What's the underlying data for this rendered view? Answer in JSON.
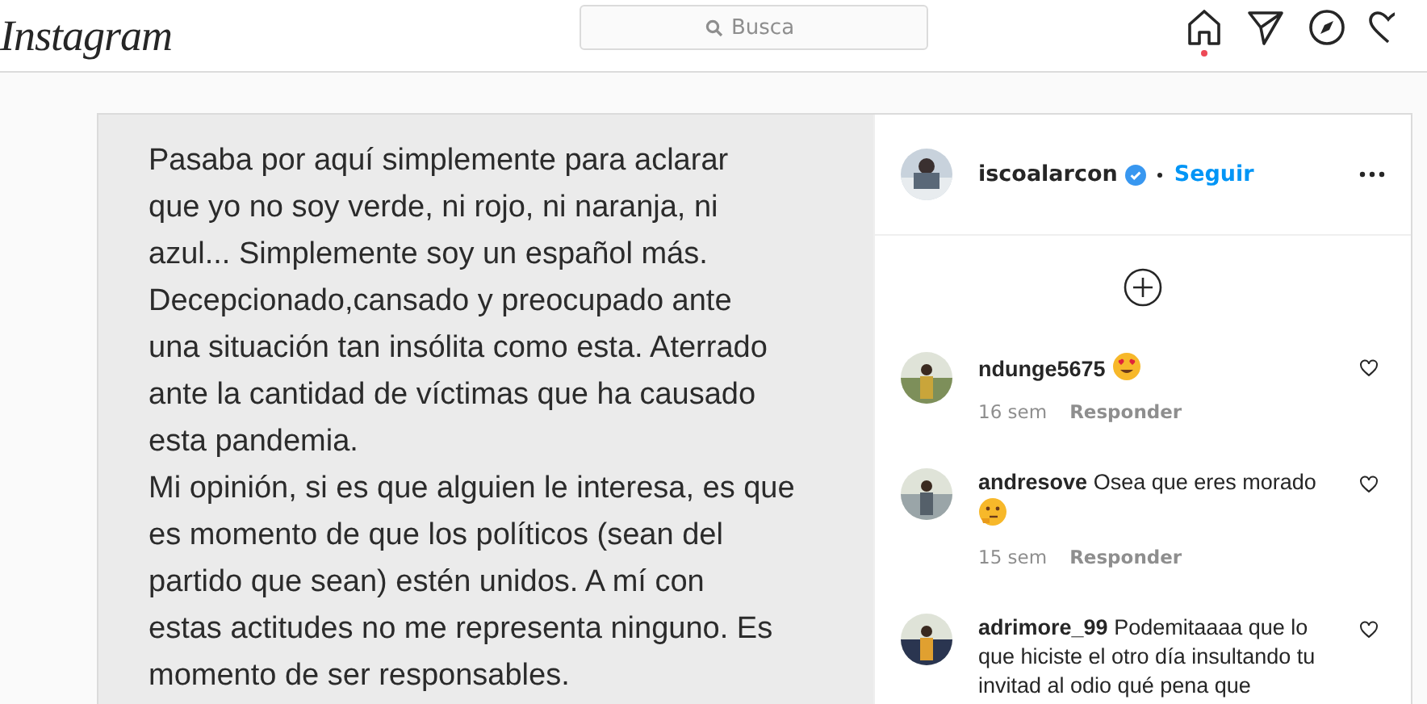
{
  "header": {
    "logo": "Instagram",
    "search": {
      "placeholder": "Busca"
    }
  },
  "post": {
    "text_lines": [
      "Pasaba por aquí simplemente para aclarar",
      "que yo no soy verde, ni rojo, ni naranja, ni",
      "azul... Simplemente soy un español más.",
      "Decepcionado,cansado y preocupado ante",
      "una situación tan insólita como esta. Aterrado",
      "ante la cantidad de víctimas que ha causado",
      "esta pandemia.",
      "Mi opinión, si es que alguien le interesa, es que",
      "es momento de que los políticos (sean del",
      "partido que sean) estén unidos. A mí con",
      "estas actitudes no me representa ninguno. Es",
      "momento de ser responsables."
    ],
    "author": {
      "username": "iscoalarcon",
      "verified": true,
      "follow": "Seguir"
    },
    "comments": [
      {
        "username": "ndunge5675",
        "kind": "hearteyes",
        "time": "16 sem",
        "reply": "Responder"
      },
      {
        "username": "andresove",
        "text": "Osea que eres morado",
        "kind": "thinking",
        "time": "15 sem",
        "reply": "Responder"
      },
      {
        "username": "adrimore_99",
        "text": "Podemitaaaa que lo que hiciste el otro día insultando tu invitad al odio qué pena que",
        "kind": "plain"
      }
    ]
  }
}
